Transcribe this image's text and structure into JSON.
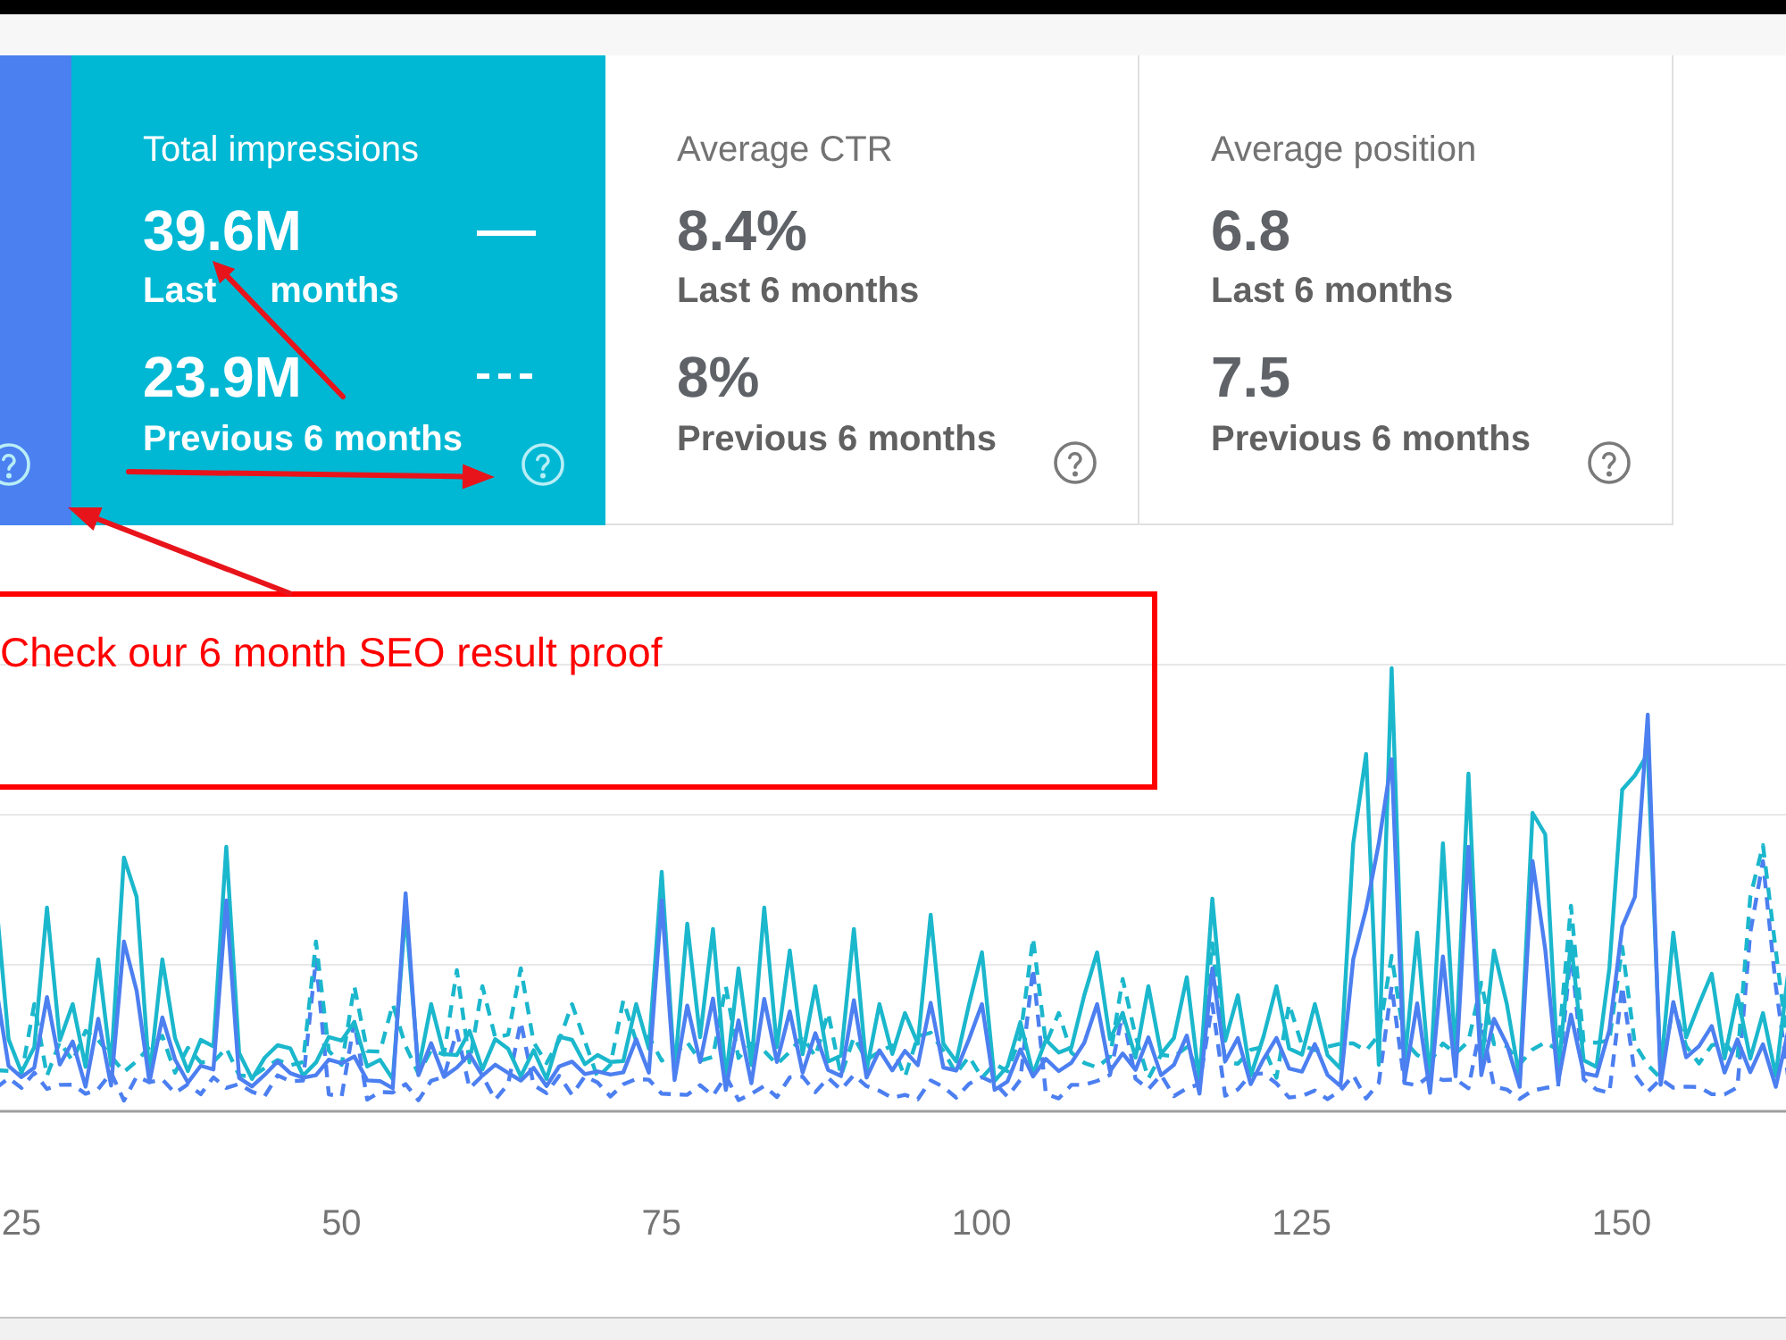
{
  "metric_cards": [
    {
      "selected": true,
      "color": "#4a80f0"
    },
    {
      "selected": true,
      "color": "#00b8d4",
      "title": "Total impressions",
      "current_value": "39.6M",
      "current_label_parts": [
        "Last",
        "months"
      ],
      "previous_value": "23.9M",
      "previous_label": "Previous 6 months"
    },
    {
      "selected": false,
      "title": "Average CTR",
      "current_value": "8.4%",
      "current_label": "Last 6 months",
      "previous_value": "8%",
      "previous_label": "Previous 6 months"
    },
    {
      "selected": false,
      "title": "Average position",
      "current_value": "6.8",
      "current_label": "Last 6 months",
      "previous_value": "7.5",
      "previous_label": "Previous 6 months"
    }
  ],
  "chart": {
    "x_axis_labels": [
      "25",
      "50",
      "75",
      "100",
      "125",
      "150"
    ]
  },
  "callout": {
    "text": "Check our 6 month SEO result proof"
  }
}
